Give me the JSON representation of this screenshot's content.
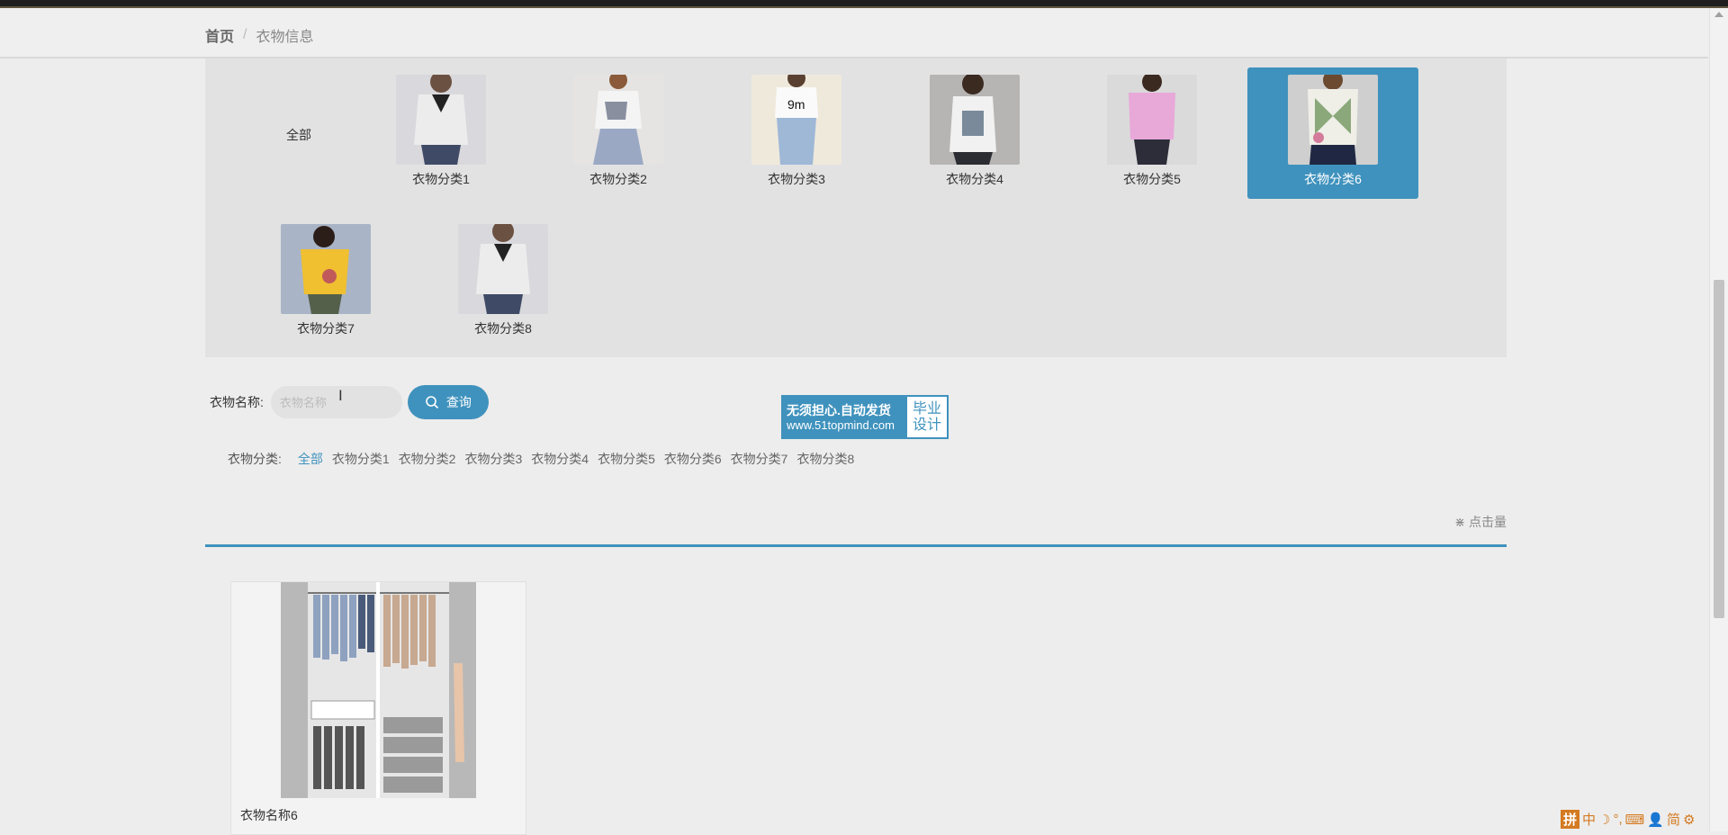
{
  "breadcrumb": {
    "home": "首页",
    "separator": "/",
    "current": "衣物信息"
  },
  "categories": {
    "all_label": "全部",
    "items": [
      {
        "label": "衣物分类1"
      },
      {
        "label": "衣物分类2"
      },
      {
        "label": "衣物分类3"
      },
      {
        "label": "衣物分类4"
      },
      {
        "label": "衣物分类5"
      },
      {
        "label": "衣物分类6",
        "active": true
      },
      {
        "label": "衣物分类7"
      },
      {
        "label": "衣物分类8"
      }
    ]
  },
  "search": {
    "label": "衣物名称:",
    "placeholder": "衣物名称",
    "value": "",
    "button_label": "查询"
  },
  "ad": {
    "line1": "无须担心.自动发货",
    "line2": "www.51topmind.com",
    "right1": "毕业",
    "right2": "设计"
  },
  "filter": {
    "title": "衣物分类:",
    "options": [
      "全部",
      "衣物分类1",
      "衣物分类2",
      "衣物分类3",
      "衣物分类4",
      "衣物分类5",
      "衣物分类6",
      "衣物分类7",
      "衣物分类8"
    ],
    "active": "全部"
  },
  "sort": {
    "label": "点击量"
  },
  "products": [
    {
      "name": "衣物名称6"
    }
  ],
  "ime": {
    "items": [
      "拼",
      "中",
      "☽",
      "°,",
      "⌨",
      "👤",
      "简",
      "⚙"
    ]
  },
  "colors": {
    "accent": "#3f92bd",
    "panel": "#e2e2e2",
    "background": "#ededed"
  }
}
